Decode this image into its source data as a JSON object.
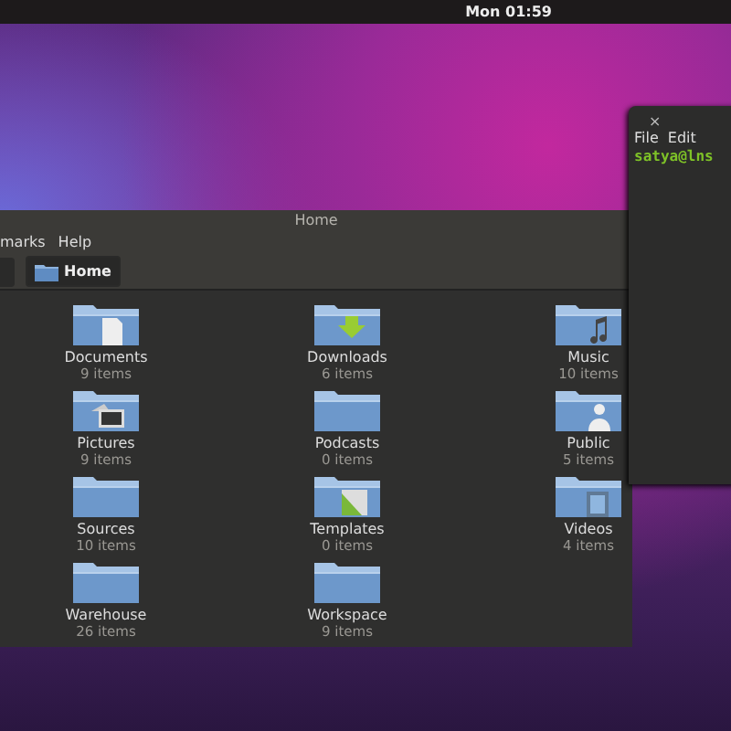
{
  "top_panel": {
    "clock": "Mon 01:59"
  },
  "file_manager": {
    "title": "Home",
    "menu": [
      "marks",
      "Help"
    ],
    "path_buttons": [
      {
        "label": "Home",
        "selected": true
      }
    ],
    "folders": [
      {
        "name": "Documents",
        "count": "9 items",
        "kind": "document"
      },
      {
        "name": "Downloads",
        "count": "6 items",
        "kind": "download"
      },
      {
        "name": "Music",
        "count": "10 items",
        "kind": "music"
      },
      {
        "name": "Pictures",
        "count": "9 items",
        "kind": "pictures"
      },
      {
        "name": "Podcasts",
        "count": "0 items",
        "kind": "plain"
      },
      {
        "name": "Public",
        "count": "5 items",
        "kind": "person"
      },
      {
        "name": "Sources",
        "count": "10 items",
        "kind": "plain"
      },
      {
        "name": "Templates",
        "count": "0 items",
        "kind": "template"
      },
      {
        "name": "Videos",
        "count": "4 items",
        "kind": "film"
      },
      {
        "name": "Warehouse",
        "count": "26 items",
        "kind": "plain"
      },
      {
        "name": "Workspace",
        "count": "9 items",
        "kind": "plain"
      }
    ]
  },
  "terminal": {
    "close": "×",
    "menu": [
      "File",
      "Edit"
    ],
    "prompt": "satya@lns"
  }
}
